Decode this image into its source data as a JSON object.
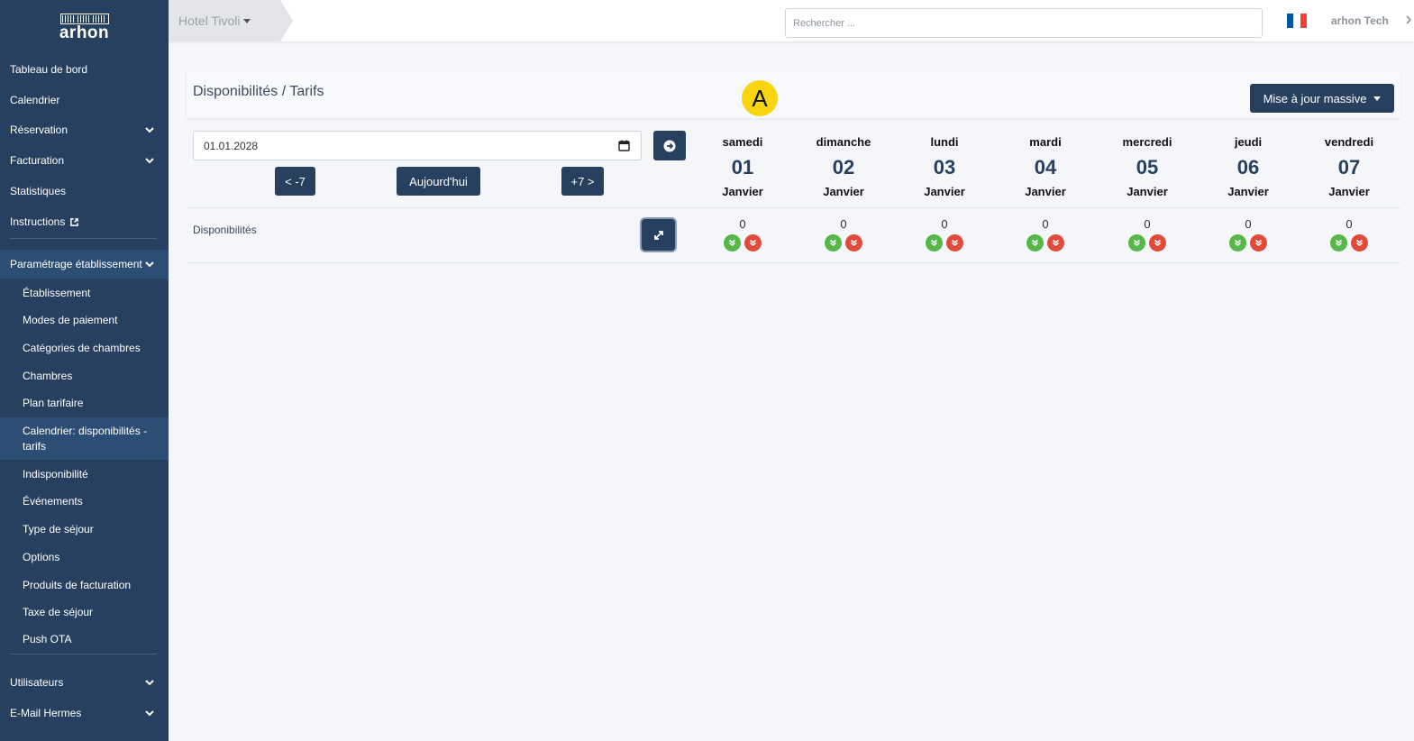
{
  "brand": {
    "logo_text": "arhon"
  },
  "sidebar": {
    "items": [
      {
        "label": "Tableau de bord"
      },
      {
        "label": "Calendrier"
      },
      {
        "label": "Réservation"
      },
      {
        "label": "Facturation"
      },
      {
        "label": "Statistiques"
      },
      {
        "label": "Instructions"
      },
      {
        "label": "Paramétrage établissement"
      },
      {
        "label": "Utilisateurs"
      },
      {
        "label": "E-Mail Hermes"
      }
    ],
    "subitems": [
      {
        "label": "Établissement"
      },
      {
        "label": "Modes de paiement"
      },
      {
        "label": "Catégories de chambres"
      },
      {
        "label": "Chambres"
      },
      {
        "label": "Plan tarifaire"
      },
      {
        "label": "Calendrier: disponibilités - tarifs"
      },
      {
        "label": "Indisponibilité"
      },
      {
        "label": "Événements"
      },
      {
        "label": "Type de séjour"
      },
      {
        "label": "Options"
      },
      {
        "label": "Produits de facturation"
      },
      {
        "label": "Taxe de séjour"
      },
      {
        "label": "Push OTA"
      }
    ]
  },
  "topbar": {
    "hotel": "Hotel Tivoli",
    "search_placeholder": "Rechercher ...",
    "user": "arhon Tech",
    "flag_colors": [
      "#0055a4",
      "#ffffff",
      "#ef4135"
    ]
  },
  "header": {
    "title": "Disponibilités / Tarifs",
    "mass_update": "Mise à jour massive",
    "marker": "A"
  },
  "controls": {
    "date": "01.01.2028",
    "prev": "< -7",
    "today": "Aujourd'hui",
    "next": "+7 >"
  },
  "days": [
    {
      "name": "samedi",
      "num": "01",
      "month": "Janvier",
      "avail": "0"
    },
    {
      "name": "dimanche",
      "num": "02",
      "month": "Janvier",
      "avail": "0"
    },
    {
      "name": "lundi",
      "num": "03",
      "month": "Janvier",
      "avail": "0"
    },
    {
      "name": "mardi",
      "num": "04",
      "month": "Janvier",
      "avail": "0"
    },
    {
      "name": "mercredi",
      "num": "05",
      "month": "Janvier",
      "avail": "0"
    },
    {
      "name": "jeudi",
      "num": "06",
      "month": "Janvier",
      "avail": "0"
    },
    {
      "name": "vendredi",
      "num": "07",
      "month": "Janvier",
      "avail": "0"
    }
  ],
  "rows": {
    "availability": "Disponibilités"
  },
  "colors": {
    "primary": "#27405f",
    "up": "#57b84a",
    "down": "#e14b3b",
    "marker": "#f7d50f"
  }
}
